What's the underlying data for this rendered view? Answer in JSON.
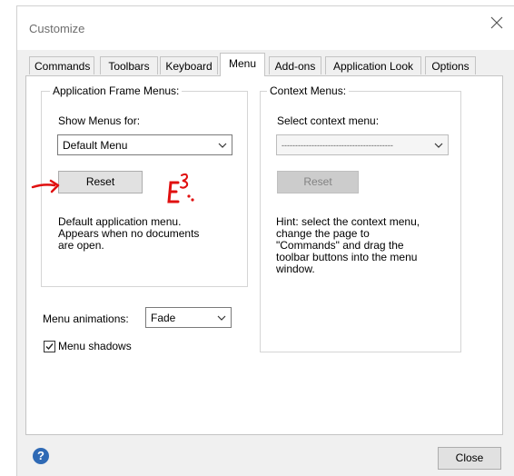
{
  "window": {
    "title": "Customize",
    "close_icon": "close-icon"
  },
  "tabs": [
    {
      "label": "Commands",
      "active": false
    },
    {
      "label": "Toolbars",
      "active": false
    },
    {
      "label": "Keyboard",
      "active": false
    },
    {
      "label": "Menu",
      "active": true
    },
    {
      "label": "Add-ons",
      "active": false
    },
    {
      "label": "Application Look",
      "active": false
    },
    {
      "label": "Options",
      "active": false
    }
  ],
  "app_frame": {
    "group_label": "Application Frame Menus:",
    "show_menus_label": "Show Menus for:",
    "show_menus_value": "Default Menu",
    "reset_label": "Reset",
    "description": [
      "Default application menu.",
      "Appears when no documents",
      "are open."
    ]
  },
  "context": {
    "group_label": "Context Menus:",
    "select_label": "Select context menu:",
    "select_value": "-----------------------------------------",
    "reset_label": "Reset",
    "hint": [
      "Hint: select the context menu,",
      "change the page to",
      "\"Commands\" and drag the",
      "toolbar buttons into the menu",
      "window."
    ]
  },
  "animations": {
    "label": "Menu animations:",
    "value": "Fade"
  },
  "shadows": {
    "label": "Menu shadows",
    "checked": true
  },
  "footer": {
    "help_label": "?",
    "close_label": "Close"
  },
  "annotations": {
    "handwritten_mark": "E3",
    "color": "#e01010"
  }
}
